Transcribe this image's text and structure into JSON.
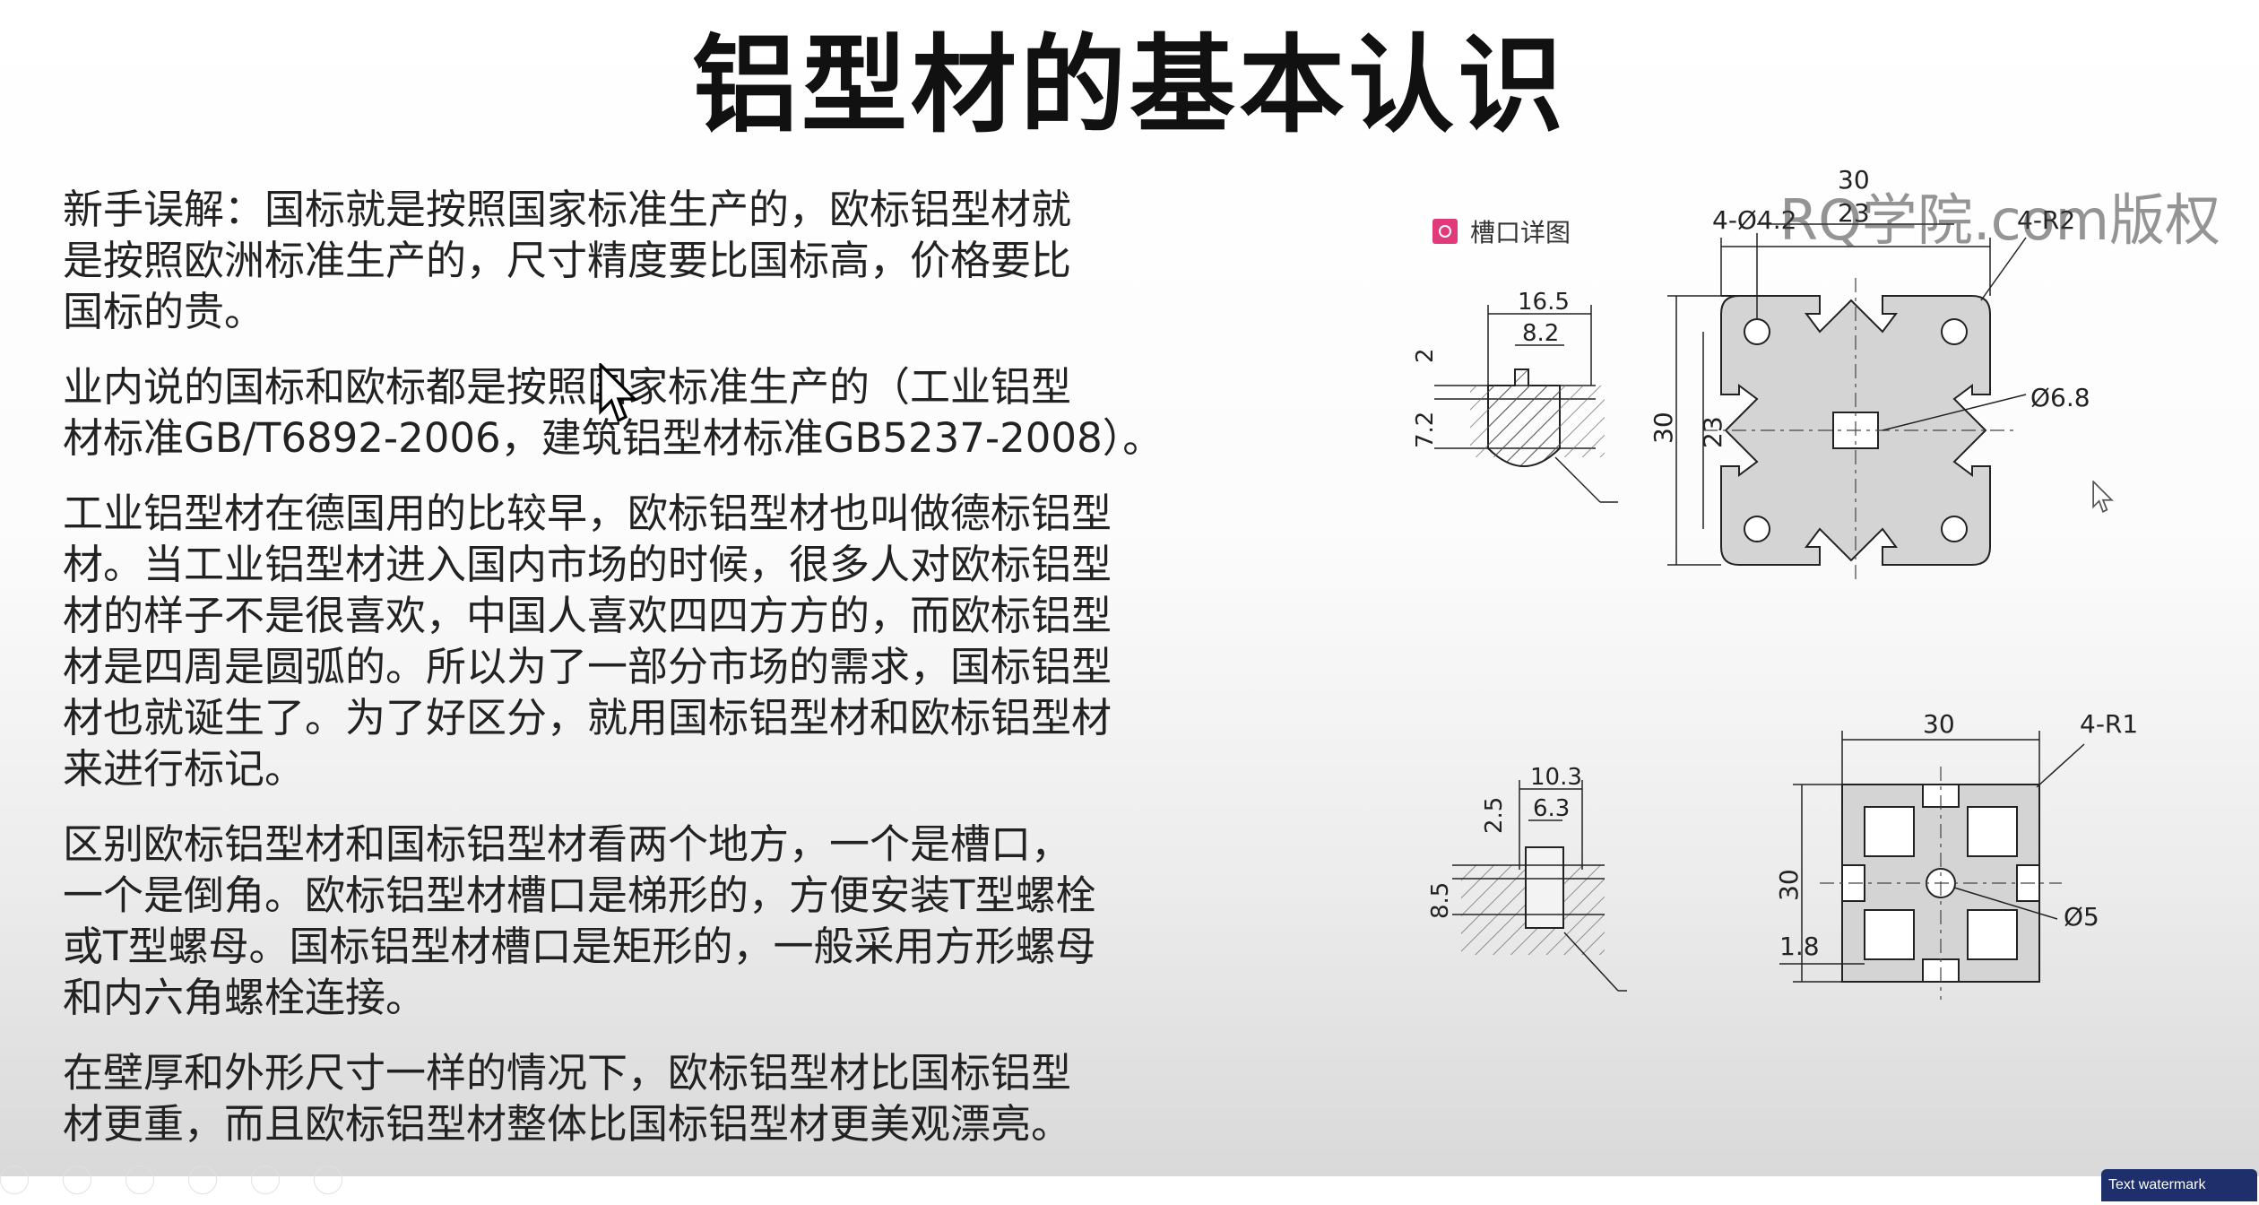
{
  "slide": {
    "title": "铝型材的基本认识",
    "paragraphs": [
      [
        "新手误解：国标就是按照国家标准生产的，欧标铝型材就",
        "是按照欧洲标准生产的，尺寸精度要比国标高，价格要比",
        "国标的贵。"
      ],
      [
        "业内说的国标和欧标都是按照国家标准生产的（工业铝型",
        "材标准GB/T6892-2006，建筑铝型材标准GB5237-2008）。"
      ],
      [
        "工业铝型材在德国用的比较早，欧标铝型材也叫做德标铝型",
        "材。当工业铝型材进入国内市场的时候，很多人对欧标铝型",
        "材的样子不是很喜欢，中国人喜欢四四方方的，而欧标铝型",
        "材是四周是圆弧的。所以为了一部分市场的需求，国标铝型",
        "材也就诞生了。为了好区分，就用国标铝型材和欧标铝型材",
        "来进行标记。"
      ],
      [
        "区别欧标铝型材和国标铝型材看两个地方，一个是槽口，",
        "一个是倒角。欧标铝型材槽口是梯形的，方便安装T型螺栓",
        "或T型螺母。国标铝型材槽口是矩形的，一般采用方形螺母",
        "和内六角螺栓连接。"
      ],
      [
        "在壁厚和外形尺寸一样的情况下，欧标铝型材比国标铝型",
        "材更重，而且欧标铝型材整体比国标铝型材更美观漂亮。"
      ]
    ],
    "watermark": "RQ学院.com版权",
    "legend_label": "槽口详图"
  },
  "drawing_top": {
    "slot_width": "16.5",
    "slot_opening": "8.2",
    "slot_depth_a": "2",
    "slot_depth_b": "7.2",
    "overall_width": "30",
    "hole_spacing": "23",
    "holes": "4-Ø4.2",
    "corner_radius": "4-R2",
    "overall_height": "30",
    "height_spacing": "23",
    "center_hole": "Ø6.8"
  },
  "drawing_bottom": {
    "slot_width": "10.3",
    "slot_opening": "6.3",
    "slot_depth_a": "2.5",
    "slot_depth_b": "8.5",
    "overall_width": "30",
    "corner_radius": "4-R1",
    "overall_height": "30",
    "wall_thickness": "1.8",
    "center_hole": "Ø5"
  },
  "footer": {
    "text_watermark_button": "Text watermark"
  },
  "colors": {
    "legend_icon": "#e03a7a",
    "button_bg": "#1e2f6b"
  }
}
